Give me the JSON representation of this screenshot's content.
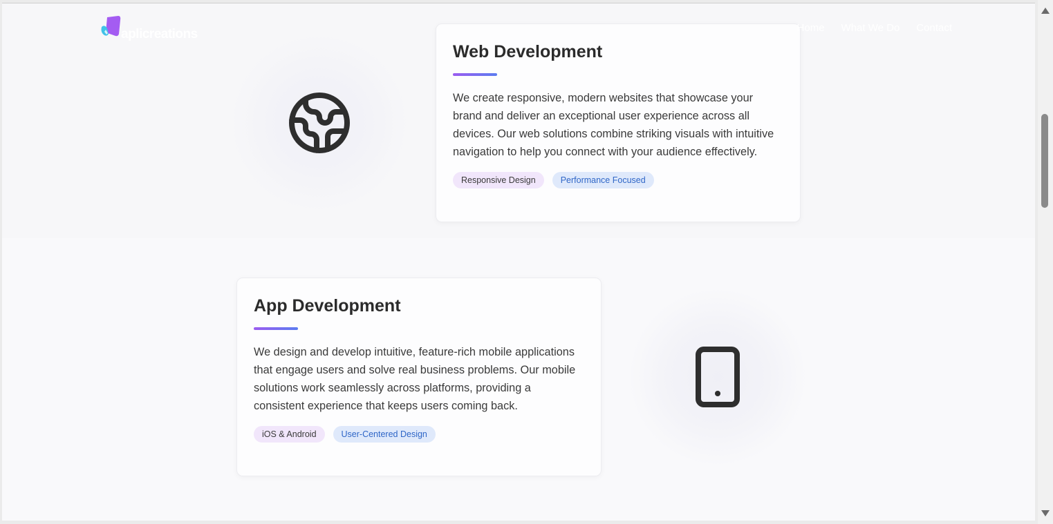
{
  "brand": {
    "logo_text": "aplicreations",
    "logo_colors": [
      "#a45cf2",
      "#41c2e8"
    ]
  },
  "nav": {
    "links": [
      "Home",
      "What We Do",
      "Contact"
    ]
  },
  "services": [
    {
      "title": "Web Development",
      "description": "We create responsive, modern websites that showcase your brand and deliver an exceptional user experience across all devices. Our web solutions combine striking visuals with intuitive navigation to help you connect with your audience effectively.",
      "tags": [
        "Responsive Design",
        "Performance Focused"
      ],
      "icon": "globe-icon"
    },
    {
      "title": "App Development",
      "description": "We design and develop intuitive, feature-rich mobile applications that engage users and solve real business problems. Our mobile solutions work seamlessly across platforms, providing a consistent experience that keeps users coming back.",
      "tags": [
        "iOS & Android",
        "User-Centered Design"
      ],
      "icon": "smartphone-icon"
    }
  ],
  "colors": {
    "accent_gradient": [
      "#9b5cf0",
      "#5b7cf0"
    ],
    "tag_purple_bg": "#f1e6fb",
    "tag_blue_bg": "#dfe9fb",
    "tag_blue_text": "#2f66c7",
    "icon_color": "#2e2e2e"
  }
}
